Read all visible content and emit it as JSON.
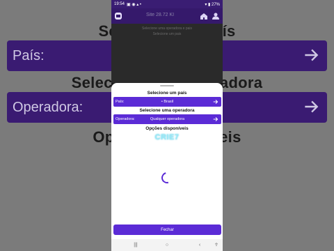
{
  "background": {
    "title_top": "Selecione um país",
    "pais_label": "País:",
    "title_middle": "Selecione uma operadora",
    "operadora_label": "Operadora:",
    "title_bottom": "Opções disponíveis"
  },
  "status_bar": {
    "time": "19:54",
    "battery": "27%"
  },
  "app_bar": {
    "title": "Site 28.72 KI"
  },
  "dim_notes": {
    "line1": "Selecione uma operadora e pais",
    "line2": "Selecione um pais"
  },
  "sheet": {
    "country_heading": "Selecione um país",
    "country_label": "País:",
    "country_value": "• Brasil",
    "operator_heading": "Selecione uma operadora",
    "operator_label": "Operadora:",
    "operator_value": "Qualquer operadora",
    "options_heading": "Opções disponíveis",
    "watermark": "CRIE7",
    "close_label": "Fechar"
  },
  "colors": {
    "accent": "#5b2bd6",
    "appbar": "#35196b",
    "watermark": "#9ae9f7"
  },
  "icons": {
    "status_icons": [
      "notification-icon",
      "wifi-icon",
      "signal-icon",
      "battery-icon"
    ],
    "app_bar": [
      "app-logo-icon",
      "home-icon",
      "profile-icon"
    ],
    "nav": [
      "recents-icon",
      "home-circle-icon",
      "back-icon",
      "accessibility-icon"
    ]
  }
}
